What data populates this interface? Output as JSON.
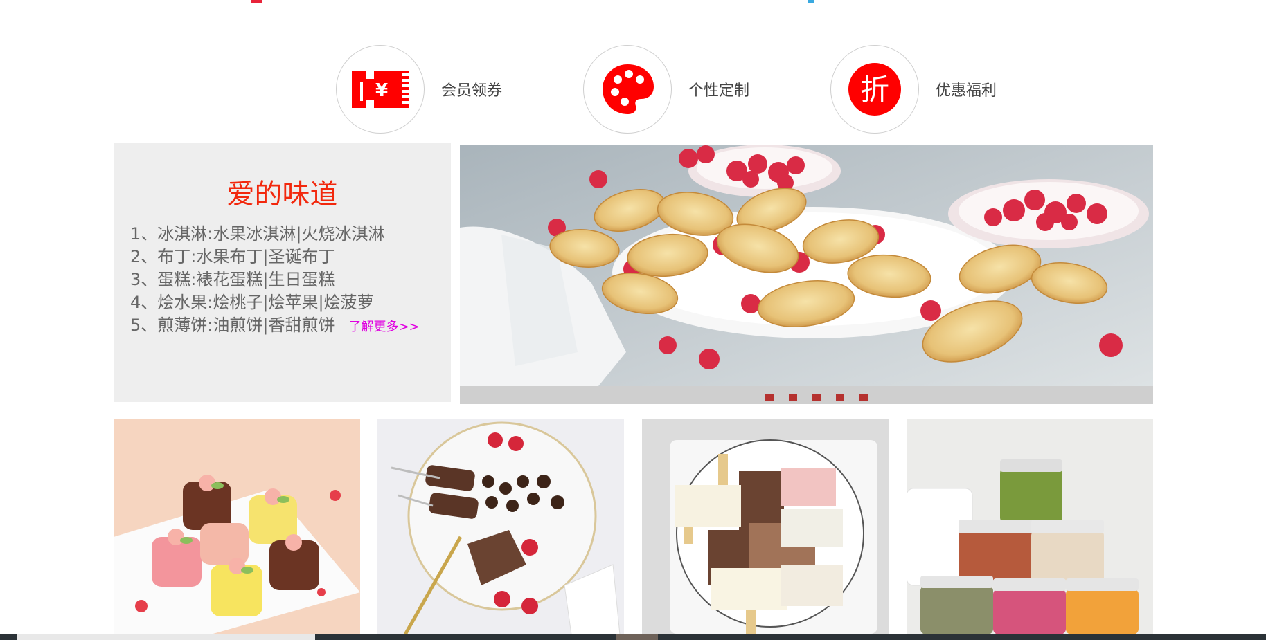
{
  "features": [
    {
      "label": "会员领券",
      "icon": "ticket-icon",
      "icon_text": "¥"
    },
    {
      "label": "个性定制",
      "icon": "palette-icon"
    },
    {
      "label": "优惠福利",
      "icon": "discount-icon",
      "icon_text": "折"
    }
  ],
  "info": {
    "title": "爱的味道",
    "items": [
      "1、冰淇淋:水果冰淇淋|火烧冰淇淋",
      "2、布丁:水果布丁|圣诞布丁",
      "3、蛋糕:裱花蛋糕|生日蛋糕",
      "4、烩水果:烩桃子|烩苹果|烩菠萝",
      "5、煎薄饼:油煎饼|香甜煎饼"
    ],
    "more_link": "了解更多>>"
  },
  "banner": {
    "image": "madeleines-raspberries-photo",
    "slide_count": 5
  },
  "products": [
    {
      "image": "mooncake-ice-cream-photo"
    },
    {
      "image": "chocolate-plate-photo"
    },
    {
      "image": "popsicles-plate-photo"
    },
    {
      "image": "vivi-jars-photo"
    }
  ],
  "colors": {
    "accent": "#f2280d",
    "icon_red": "#ff0000",
    "link": "#e000e0",
    "dot": "#b5312f",
    "panel_bg": "#eeeeee"
  }
}
